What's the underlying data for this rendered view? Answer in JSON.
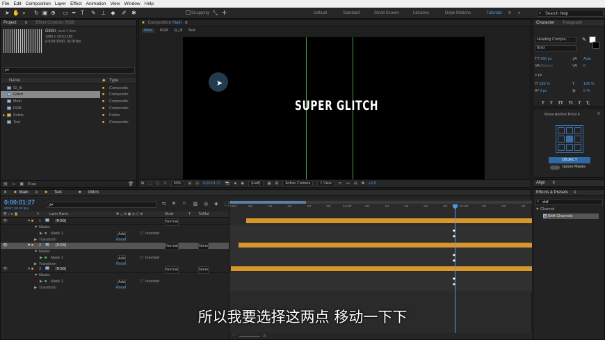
{
  "menu": [
    "File",
    "Edit",
    "Composition",
    "Layer",
    "Effect",
    "Animation",
    "View",
    "Window",
    "Help"
  ],
  "toolbar": {
    "snapping": "Snapping",
    "workspaces": [
      "Default",
      "Standard",
      "Small Screen",
      "Libraries",
      "Dope Motions",
      "Tutorials"
    ],
    "active_workspace": "Tutorials",
    "search": "Search Help"
  },
  "project": {
    "tab": "Project",
    "effect_tab": "Effect Controls: RGB",
    "item_name": "Glitch",
    "item_used": ", used 1 time",
    "item_size": "1280 x 720 (1.00)",
    "item_dur": "Δ 0;00;10;00, 30.00 fps",
    "search_placeholder": "ρ▾",
    "col_name": "Name",
    "col_type": "Type",
    "items": [
      {
        "name": "Gl_itl",
        "type": "Compositio"
      },
      {
        "name": "Glitch",
        "type": "Compositio"
      },
      {
        "name": "Main",
        "type": "Compositio"
      },
      {
        "name": "RGB",
        "type": "Compositio"
      },
      {
        "name": "Solids",
        "type": "Folder"
      },
      {
        "name": "Text",
        "type": "Compositio"
      }
    ],
    "bpc": "8 bpc"
  },
  "comp": {
    "tab_prefix": "Composition",
    "tab_name": "Main",
    "crumbs": [
      "Main",
      "RGB",
      "Gl_itl",
      "Text"
    ],
    "headline": "SUPER GLITCH",
    "zoom": "50%",
    "time": "0;00;01;27",
    "quality": "(Half)",
    "camera": "Active Camera",
    "view": "1 View",
    "exposure": "+0.0"
  },
  "character": {
    "tab": "Character",
    "tab2": "Paragraph",
    "font": "Heading Compre...",
    "style": "Bold",
    "size": "965 px",
    "leading": "Auto",
    "kerning": "Metrics",
    "tracking": "0",
    "stroke": "px",
    "vscale": "100 %",
    "hscale": "100 %",
    "baseline": "0 px",
    "tsume": "0 %",
    "styles": [
      "T",
      "T",
      "TT",
      "Tt",
      "T",
      "T,"
    ]
  },
  "anchor": {
    "title": "Move Anchor Point 4",
    "button": "OBJECT",
    "ignore": "Ignore Masks"
  },
  "align": {
    "tab": "Align"
  },
  "effects": {
    "tab": "Effects & Presets",
    "search": "shif",
    "category": "Channel",
    "item": "Shift Channels"
  },
  "timeline": {
    "tabs": [
      "Main",
      "Text",
      "Glitch"
    ],
    "time": "0:00:01:27",
    "fps": "00057 (30.00 fps)",
    "search": "ρ▾",
    "cols": [
      "#",
      "Layer Name",
      "Mode",
      "T",
      "TrkMat"
    ],
    "ruler": [
      "0:00f",
      "05f",
      "10f",
      "15f",
      "20f",
      "25f",
      "01:00f",
      "05f",
      "10f",
      "15f",
      "20f",
      "25f",
      "02:00f",
      "05f",
      "10f",
      "15f"
    ],
    "layers": [
      {
        "num": "1",
        "name": "[RGB]",
        "mode": "Normal",
        "trk": ""
      },
      {
        "num": "2",
        "name": "[RGB]",
        "mode": "Normal",
        "trk": "None"
      },
      {
        "num": "3",
        "name": "[RGB]",
        "mode": "Normal",
        "trk": "None"
      }
    ],
    "masks": "Masks",
    "mask1": "Mask 1",
    "add": "Add",
    "inverted": "Inverted",
    "transform": "Transform",
    "reset": "Reset"
  },
  "subtitle": "所以我要选择这两点 移动一下下",
  "colors": {
    "accent": "#4d9ce6",
    "bar": "#d9962e",
    "label_orange": "#e3a53c"
  }
}
